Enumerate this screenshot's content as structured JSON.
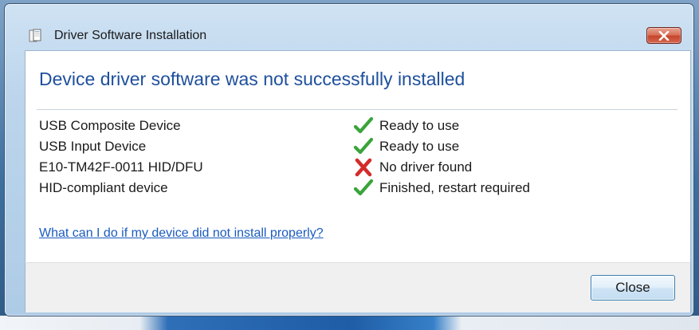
{
  "window": {
    "title": "Driver Software Installation",
    "title_icon": "driver-install-icon",
    "close_icon": "close-icon"
  },
  "content": {
    "heading": "Device driver software was not successfully installed",
    "devices": [
      {
        "name": "USB Composite Device",
        "status": "Ready to use",
        "status_icon": "green-check-icon"
      },
      {
        "name": "USB Input Device",
        "status": "Ready to use",
        "status_icon": "green-check-icon"
      },
      {
        "name": "E10-TM42F-0011 HID/DFU",
        "status": "No driver found",
        "status_icon": "red-x-icon"
      },
      {
        "name": "HID-compliant device",
        "status": "Finished, restart required",
        "status_icon": "green-check-icon"
      }
    ],
    "help_link": "What can I do if my device did not install properly?"
  },
  "footer": {
    "close_label": "Close"
  },
  "colors": {
    "heading": "#1e4f9c",
    "link": "#1a5bbf",
    "check_green": "#3aa43a",
    "error_red": "#d42b2b",
    "titlebar_close": "#c6452c"
  }
}
